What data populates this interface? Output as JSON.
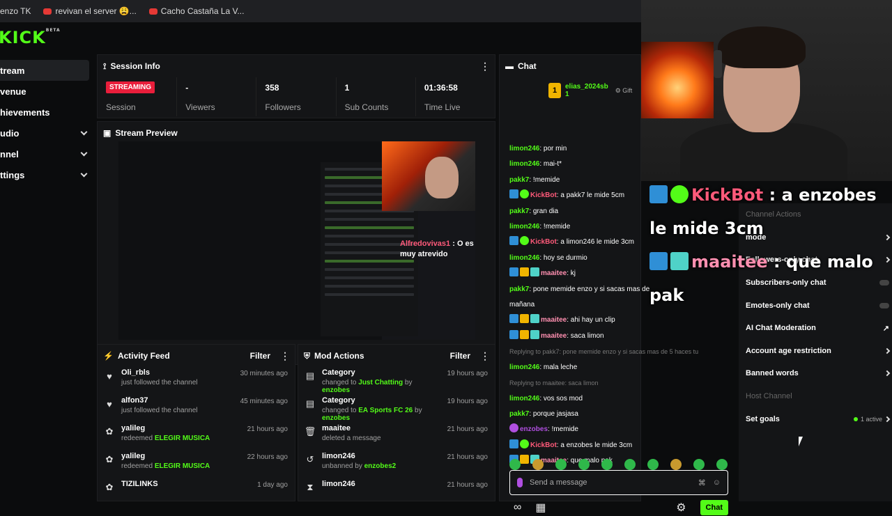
{
  "bookmarks": [
    {
      "label": "enzo TK",
      "icon": "none"
    },
    {
      "label": "revivan el server 😩...",
      "icon": "youtube-icon"
    },
    {
      "label": "Cacho Castaña La V...",
      "icon": "youtube-icon"
    }
  ],
  "logo": "KICK",
  "logo_sup": "BETA",
  "sidebar": {
    "items": [
      {
        "label": "tream",
        "expand": false,
        "active": true
      },
      {
        "label": "venue",
        "expand": false,
        "active": false
      },
      {
        "label": "hievements",
        "expand": false,
        "active": false
      },
      {
        "label": "udio",
        "expand": true,
        "active": false
      },
      {
        "label": "nnel",
        "expand": true,
        "active": false
      },
      {
        "label": "ttings",
        "expand": true,
        "active": false
      }
    ]
  },
  "session": {
    "title": "Session Info",
    "stats": [
      {
        "value": "STREAMING",
        "label": "Session",
        "badge": true
      },
      {
        "value": "-",
        "label": "Viewers"
      },
      {
        "value": "358",
        "label": "Followers"
      },
      {
        "value": "1",
        "label": "Sub Counts"
      },
      {
        "value": "01:36:58",
        "label": "Time Live"
      }
    ]
  },
  "preview": {
    "title": "Stream Preview",
    "overlay_user": "Alfredovivas1",
    "overlay_msg": ": O es",
    "overlay_msg2": "muy atrevido"
  },
  "activity": {
    "title": "Activity Feed",
    "filter": "Filter",
    "rows": [
      {
        "icon": "heart",
        "name": "Oli_rbls",
        "desc": "just followed the channel",
        "time": "30 minutes ago"
      },
      {
        "icon": "heart",
        "name": "alfon37",
        "desc": "just followed the channel",
        "time": "45 minutes ago"
      },
      {
        "icon": "points",
        "name": "yalileg",
        "desc": "redeemed ",
        "highlight": "ELEGIR MUSICA",
        "time": "21 hours ago"
      },
      {
        "icon": "points",
        "name": "yalileg",
        "desc": "redeemed ",
        "highlight": "ELEGIR MUSICA",
        "time": "22 hours ago"
      },
      {
        "icon": "points",
        "name": "TIZILINKS",
        "desc": "",
        "time": "1 day ago"
      }
    ]
  },
  "mod": {
    "title": "Mod Actions",
    "filter": "Filter",
    "rows": [
      {
        "icon": "category",
        "name": "Category",
        "pre": "changed to ",
        "g1": "Just Chatting",
        "mid": " by ",
        "g2": "enzobes",
        "time": "19 hours ago"
      },
      {
        "icon": "category",
        "name": "Category",
        "pre": "changed to ",
        "g1": "EA Sports FC 26",
        "mid": " by ",
        "g2": "enzobes",
        "time": "19 hours ago"
      },
      {
        "icon": "trash",
        "name": "maaitee",
        "pre": "deleted a message",
        "g1": "",
        "mid": "",
        "g2": "",
        "time": "21 hours ago"
      },
      {
        "icon": "undo",
        "name": "limon246",
        "pre": "unbanned by ",
        "g1": "enzobes2",
        "mid": "",
        "g2": "",
        "time": "21 hours ago"
      },
      {
        "icon": "filter",
        "name": "limon246",
        "pre": "",
        "g1": "",
        "mid": "",
        "g2": "",
        "time": "21 hours ago"
      }
    ]
  },
  "chat": {
    "title": "Chat",
    "gifter_rank": "1",
    "gifter_name": "elias_2024sb",
    "gifter_sub": "1",
    "gift_label": "Gift",
    "messages": [
      {
        "user": "limon246",
        "ucolor": "#53fc18",
        "badges": [],
        "text": ": por min"
      },
      {
        "user": "limon246",
        "ucolor": "#53fc18",
        "badges": [],
        "text": ": mai-t*"
      },
      {
        "user": "pakk7",
        "ucolor": "#53fc18",
        "badges": [],
        "text": ": !memide"
      },
      {
        "user": "KickBot",
        "ucolor": "#ff5a7a",
        "badges": [
          "mod",
          "ver"
        ],
        "text": ": a pakk7 le mide 5cm"
      },
      {
        "user": "pakk7",
        "ucolor": "#53fc18",
        "badges": [],
        "text": ": gran dia"
      },
      {
        "user": "limon246",
        "ucolor": "#53fc18",
        "badges": [],
        "text": ": !memide"
      },
      {
        "user": "KickBot",
        "ucolor": "#ff5a7a",
        "badges": [
          "mod",
          "ver"
        ],
        "text": ": a limon246 le mide 3cm"
      },
      {
        "user": "limon246",
        "ucolor": "#53fc18",
        "badges": [],
        "text": ": hoy se durmio"
      },
      {
        "user": "maaitee",
        "ucolor": "#ff8fb0",
        "badges": [
          "mod",
          "crown",
          "sub"
        ],
        "text": ": kj"
      },
      {
        "user": "pakk7",
        "ucolor": "#53fc18",
        "badges": [],
        "text": ": pone memide enzo y si sacas mas de"
      },
      {
        "user": "",
        "ucolor": "#fff",
        "badges": [],
        "text": "mañana"
      },
      {
        "user": "maaitee",
        "ucolor": "#ff8fb0",
        "badges": [
          "mod",
          "crown",
          "sub"
        ],
        "text": ": ahi hay un clip"
      },
      {
        "user": "maaitee",
        "ucolor": "#ff8fb0",
        "badges": [
          "mod",
          "crown",
          "sub"
        ],
        "text": ": saca limon"
      },
      {
        "user": "",
        "ucolor": "#777",
        "badges": [],
        "text": "Replying to pakk7: pone memide enzo y si sacas mas de 5 haces tu",
        "reply": true
      },
      {
        "user": "limon246",
        "ucolor": "#53fc18",
        "badges": [],
        "text": ": mala leche"
      },
      {
        "user": "",
        "ucolor": "#777",
        "badges": [],
        "text": "Replying to maaitee: saca limon",
        "reply": true
      },
      {
        "user": "limon246",
        "ucolor": "#53fc18",
        "badges": [],
        "text": ": vos sos mod"
      },
      {
        "user": "pakk7",
        "ucolor": "#53fc18",
        "badges": [],
        "text": ": porque jasjasa"
      },
      {
        "user": "enzobes",
        "ucolor": "#b04fe0",
        "badges": [
          "mic"
        ],
        "text": ": !memide"
      },
      {
        "user": "KickBot",
        "ucolor": "#ff5a7a",
        "badges": [
          "mod",
          "ver"
        ],
        "text": ": a enzobes le mide 3cm"
      },
      {
        "user": "maaitee",
        "ucolor": "#ff8fb0",
        "badges": [
          "mod",
          "crown",
          "sub"
        ],
        "text": ": que malo pak"
      }
    ],
    "placeholder": "Send a message",
    "send_label": "Chat"
  },
  "overlay": {
    "line1_user": "KickBot",
    "line1_text": " : a enzobes",
    "line2_text": "le mide 3cm",
    "line3_user": "maaitee",
    "line3_text": " : que malo",
    "line4_text": "pak"
  },
  "controls": {
    "rows": [
      {
        "label": "Channel Actions",
        "kind": "none",
        "dim": true
      },
      {
        "label": "mode",
        "kind": "arrow",
        "dim": false
      },
      {
        "label": "Followers-only chat",
        "kind": "arrow",
        "dim": false
      },
      {
        "label": "Subscribers-only chat",
        "kind": "toggle",
        "dim": false
      },
      {
        "label": "Emotes-only chat",
        "kind": "toggle",
        "dim": false
      },
      {
        "label": "AI Chat Moderation",
        "kind": "ext",
        "dim": false
      },
      {
        "label": "Account age restriction",
        "kind": "arrow",
        "dim": false
      },
      {
        "label": "Banned words",
        "kind": "arrow",
        "dim": false
      },
      {
        "label": "Host Channel",
        "kind": "none",
        "dim": true
      },
      {
        "label": "Set goals",
        "kind": "active",
        "dim": false,
        "extra": "1 active"
      }
    ]
  }
}
